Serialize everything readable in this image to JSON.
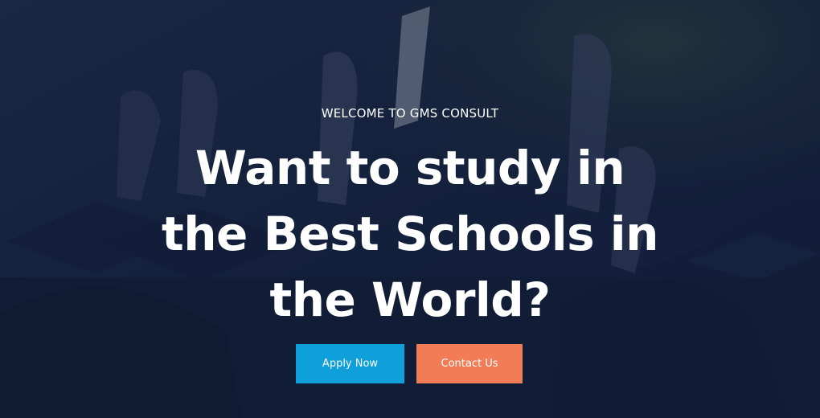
{
  "hero": {
    "eyebrow": "WELCOME TO GMS CONSULT",
    "headline": "Want to study in the Best Schools in the World?",
    "background_image": "graduates-raising-hands-with-caps",
    "overlay_color": "#121E3A"
  },
  "actions": {
    "apply_label": "Apply Now",
    "contact_label": "Contact Us",
    "apply_color": "#0F9FDB",
    "contact_color": "#F27C56"
  }
}
